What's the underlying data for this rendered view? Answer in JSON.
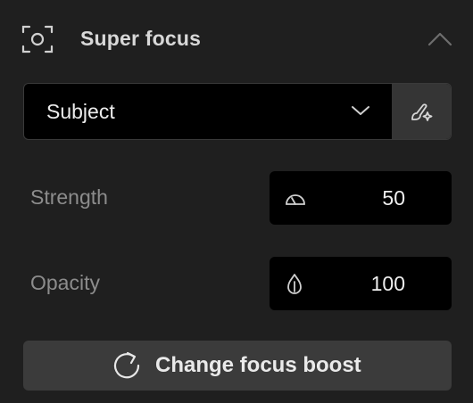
{
  "header": {
    "title": "Super focus",
    "icon": "focus-frame-icon",
    "collapse_icon": "chevron-up-icon"
  },
  "subject_select": {
    "value": "Subject",
    "icon": "chevron-down-icon",
    "brush_icon": "brush-sparkle-icon"
  },
  "strength": {
    "label": "Strength",
    "value": "50",
    "icon": "gauge-icon"
  },
  "opacity": {
    "label": "Opacity",
    "value": "100",
    "icon": "drop-icon"
  },
  "boost_button": {
    "label": "Change focus boost",
    "icon": "refresh-icon"
  },
  "colors": {
    "background": "#1f1f1f",
    "input_bg": "#000000",
    "button_bg": "#3b3b3b",
    "text": "#e6e6e6",
    "muted_text": "#8c8c8c"
  }
}
